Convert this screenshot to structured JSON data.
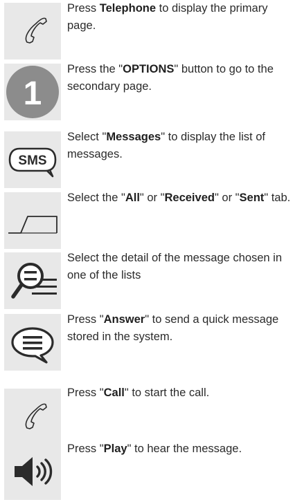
{
  "steps": [
    {
      "id": "telephone",
      "icon": "telephone-handset-icon",
      "parts": [
        {
          "t": "Press "
        },
        {
          "t": "Telephone",
          "b": true
        },
        {
          "t": " to display the primary page."
        }
      ]
    },
    {
      "id": "options",
      "icon": "number-1-badge-icon",
      "icon_label": "1",
      "parts": [
        {
          "t": "Press the \""
        },
        {
          "t": "OPTIONS",
          "b": true
        },
        {
          "t": "\" button to go to the secondary page."
        }
      ]
    },
    {
      "id": "messages",
      "icon": "sms-bubble-icon",
      "icon_label": "SMS",
      "parts": [
        {
          "t": "Select \""
        },
        {
          "t": "Messages",
          "b": true
        },
        {
          "t": "\" to display the list of messages."
        }
      ]
    },
    {
      "id": "tabs",
      "icon": "tab-icon",
      "parts": [
        {
          "t": "Select the \""
        },
        {
          "t": "All",
          "b": true
        },
        {
          "t": "\" or \""
        },
        {
          "t": "Received",
          "b": true
        },
        {
          "t": "\" or \""
        },
        {
          "t": "Sent",
          "b": true
        },
        {
          "t": "\" tab."
        }
      ]
    },
    {
      "id": "detail",
      "icon": "detail-magnifier-list-icon",
      "parts": [
        {
          "t": "Select the detail of the message chosen in one of the lists"
        }
      ]
    },
    {
      "id": "answer",
      "icon": "message-bubble-icon",
      "parts": [
        {
          "t": "Press \""
        },
        {
          "t": "Answer",
          "b": true
        },
        {
          "t": "\" to send a quick message stored in the system."
        }
      ]
    },
    {
      "id": "call",
      "icon": "telephone-handset-icon",
      "parts": [
        {
          "t": "Press \""
        },
        {
          "t": "Call",
          "b": true
        },
        {
          "t": "\" to start the call."
        }
      ]
    },
    {
      "id": "play",
      "icon": "speaker-volume-icon",
      "parts": [
        {
          "t": "Press \""
        },
        {
          "t": "Play",
          "b": true
        },
        {
          "t": "\" to hear the message."
        }
      ]
    }
  ],
  "colors": {
    "tile": "#e8e8e8",
    "badge": "#8c8c8c",
    "stroke": "#2b2b2b",
    "text": "#2b2b2b"
  }
}
